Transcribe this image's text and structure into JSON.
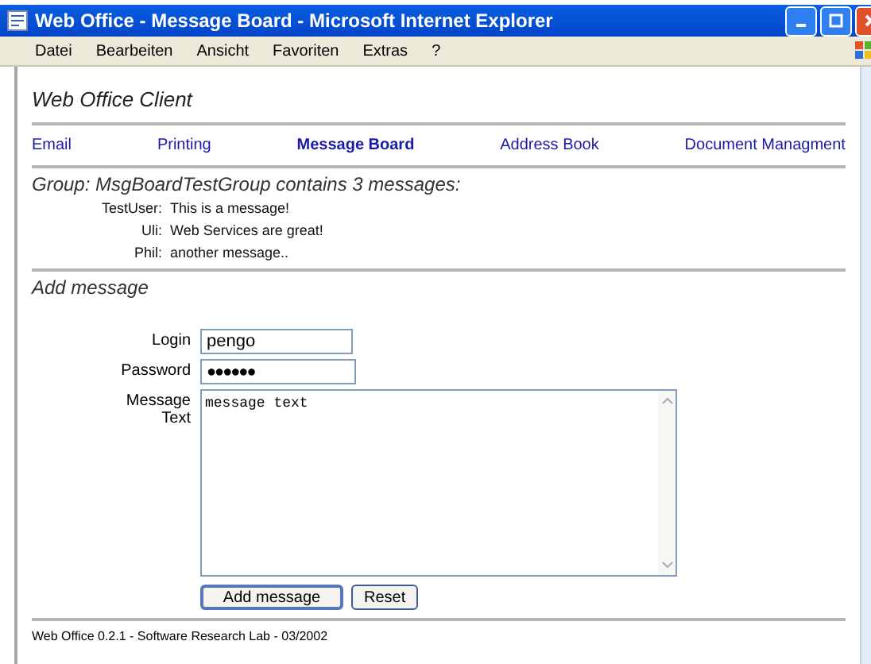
{
  "window": {
    "title": "Web Office - Message Board - Microsoft Internet Explorer"
  },
  "menu": [
    "Datei",
    "Bearbeiten",
    "Ansicht",
    "Favoriten",
    "Extras",
    "?"
  ],
  "page_title": "Web Office Client",
  "nav": [
    {
      "label": "Email",
      "selected": false
    },
    {
      "label": "Printing",
      "selected": false
    },
    {
      "label": "Message Board",
      "selected": true
    },
    {
      "label": "Address Book",
      "selected": false
    },
    {
      "label": "Document Managment",
      "selected": false
    }
  ],
  "group_heading": "Group: MsgBoardTestGroup contains 3 messages:",
  "messages": [
    {
      "user": "TestUser:",
      "text": "This is a message!"
    },
    {
      "user": "Uli:",
      "text": "Web Services are great!"
    },
    {
      "user": "Phil:",
      "text": "another message.."
    }
  ],
  "form": {
    "heading": "Add message",
    "login_label": "Login",
    "login_value": "pengo",
    "password_label": "Password",
    "password_value": "●●●●●●",
    "message_label": "Message Text",
    "message_value": "message text",
    "buttons": [
      "Add message",
      "Reset"
    ]
  },
  "footer": "Web Office 0.2.1 - Software Research Lab - 03/2002"
}
